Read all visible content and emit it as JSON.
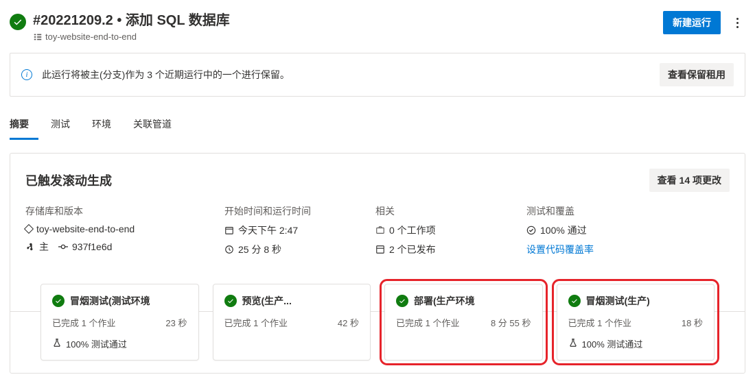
{
  "header": {
    "title": "#20221209.2 • 添加 SQL 数据库",
    "subtitle": "toy-website-end-to-end",
    "new_run": "新建运行"
  },
  "banner": {
    "text": "此运行将被主(分支)作为 3 个近期运行中的一个进行保留。",
    "action": "查看保留租用"
  },
  "tabs": {
    "summary": "摘要",
    "tests": "测试",
    "environments": "环境",
    "related": "关联管道"
  },
  "summary": {
    "title": "已触发滚动生成",
    "view_changes": "查看 14 项更改",
    "cols": {
      "repo_label": "存储库和版本",
      "repo_name": "toy-website-end-to-end",
      "branch": "主",
      "commit": "937f1e6d",
      "time_label": "开始时间和运行时间",
      "started": "今天下午 2:47",
      "duration": "25 分 8 秒",
      "related_label": "相关",
      "work_items": "0 个工作项",
      "published": "2 个已发布",
      "tests_label": "测试和覆盖",
      "pass_rate": "100% 通过",
      "coverage": "设置代码覆盖率"
    }
  },
  "stages": [
    {
      "name": "冒烟测试(测试环境",
      "dur": "23 秒",
      "jobs": "已完成 1 个作业",
      "test": "100% 测试通过",
      "hl": false
    },
    {
      "name": "预览(生产...",
      "dur": "42 秒",
      "jobs": "已完成 1 个作业",
      "test": "",
      "hl": false
    },
    {
      "name": "部署(生产环境",
      "dur": "8 分 55 秒",
      "jobs": "已完成 1 个作业",
      "test": "",
      "hl": true
    },
    {
      "name": "冒烟测试(生产)",
      "dur": "18 秒",
      "jobs": "已完成 1 个作业",
      "test": "100% 测试通过",
      "hl": true
    }
  ]
}
